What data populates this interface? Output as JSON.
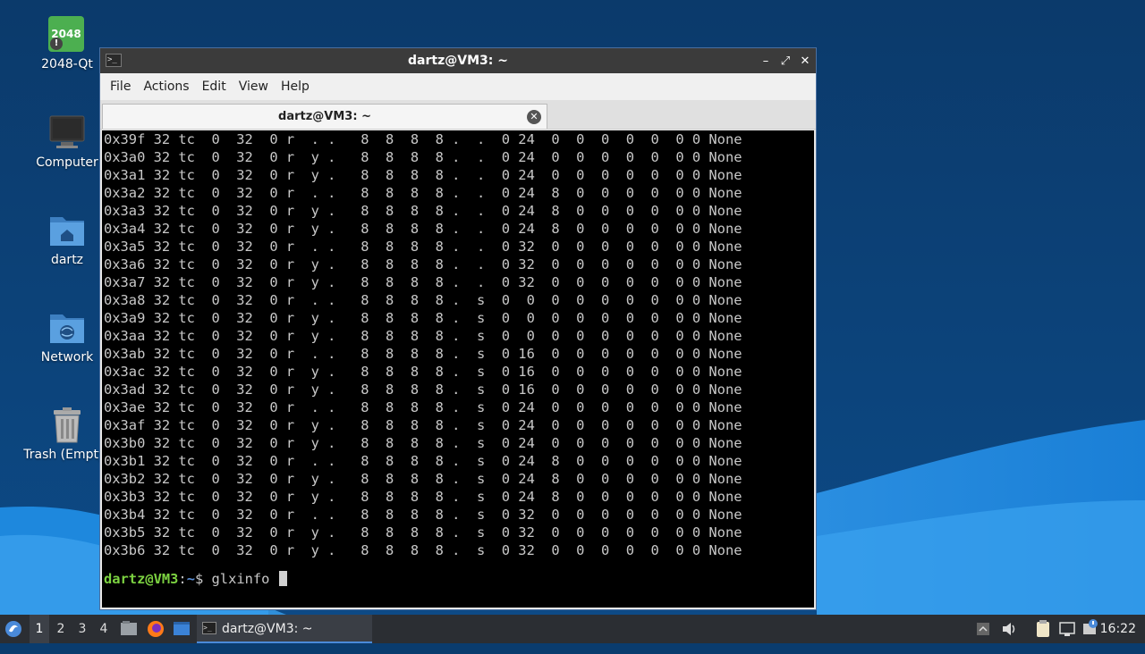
{
  "desktop": {
    "icons": [
      {
        "label": "2048-Qt",
        "icon": "2048-app-icon",
        "badge": "2048"
      },
      {
        "label": "Computer",
        "icon": "computer-icon"
      },
      {
        "label": "dartz",
        "icon": "home-folder-icon"
      },
      {
        "label": "Network",
        "icon": "network-folder-icon"
      },
      {
        "label": "Trash (Empty)",
        "icon": "trash-icon"
      }
    ]
  },
  "window": {
    "title": "dartz@VM3: ~",
    "controls": {
      "minimize": "–",
      "maximize": "⤢",
      "close": "✕"
    },
    "menu": [
      "File",
      "Actions",
      "Edit",
      "View",
      "Help"
    ],
    "tab": {
      "label": "dartz@VM3: ~",
      "close": "✕"
    }
  },
  "terminal": {
    "lines": [
      "0x39f 32 tc  0  32  0 r  . .   8  8  8  8 .  .  0 24  0  0  0  0  0  0 0 None",
      "0x3a0 32 tc  0  32  0 r  y .   8  8  8  8 .  .  0 24  0  0  0  0  0  0 0 None",
      "0x3a1 32 tc  0  32  0 r  y .   8  8  8  8 .  .  0 24  0  0  0  0  0  0 0 None",
      "0x3a2 32 tc  0  32  0 r  . .   8  8  8  8 .  .  0 24  8  0  0  0  0  0 0 None",
      "0x3a3 32 tc  0  32  0 r  y .   8  8  8  8 .  .  0 24  8  0  0  0  0  0 0 None",
      "0x3a4 32 tc  0  32  0 r  y .   8  8  8  8 .  .  0 24  8  0  0  0  0  0 0 None",
      "0x3a5 32 tc  0  32  0 r  . .   8  8  8  8 .  .  0 32  0  0  0  0  0  0 0 None",
      "0x3a6 32 tc  0  32  0 r  y .   8  8  8  8 .  .  0 32  0  0  0  0  0  0 0 None",
      "0x3a7 32 tc  0  32  0 r  y .   8  8  8  8 .  .  0 32  0  0  0  0  0  0 0 None",
      "0x3a8 32 tc  0  32  0 r  . .   8  8  8  8 .  s  0  0  0  0  0  0  0  0 0 None",
      "0x3a9 32 tc  0  32  0 r  y .   8  8  8  8 .  s  0  0  0  0  0  0  0  0 0 None",
      "0x3aa 32 tc  0  32  0 r  y .   8  8  8  8 .  s  0  0  0  0  0  0  0  0 0 None",
      "0x3ab 32 tc  0  32  0 r  . .   8  8  8  8 .  s  0 16  0  0  0  0  0  0 0 None",
      "0x3ac 32 tc  0  32  0 r  y .   8  8  8  8 .  s  0 16  0  0  0  0  0  0 0 None",
      "0x3ad 32 tc  0  32  0 r  y .   8  8  8  8 .  s  0 16  0  0  0  0  0  0 0 None",
      "0x3ae 32 tc  0  32  0 r  . .   8  8  8  8 .  s  0 24  0  0  0  0  0  0 0 None",
      "0x3af 32 tc  0  32  0 r  y .   8  8  8  8 .  s  0 24  0  0  0  0  0  0 0 None",
      "0x3b0 32 tc  0  32  0 r  y .   8  8  8  8 .  s  0 24  0  0  0  0  0  0 0 None",
      "0x3b1 32 tc  0  32  0 r  . .   8  8  8  8 .  s  0 24  8  0  0  0  0  0 0 None",
      "0x3b2 32 tc  0  32  0 r  y .   8  8  8  8 .  s  0 24  8  0  0  0  0  0 0 None",
      "0x3b3 32 tc  0  32  0 r  y .   8  8  8  8 .  s  0 24  8  0  0  0  0  0 0 None",
      "0x3b4 32 tc  0  32  0 r  . .   8  8  8  8 .  s  0 32  0  0  0  0  0  0 0 None",
      "0x3b5 32 tc  0  32  0 r  y .   8  8  8  8 .  s  0 32  0  0  0  0  0  0 0 None",
      "0x3b6 32 tc  0  32  0 r  y .   8  8  8  8 .  s  0 32  0  0  0  0  0  0 0 None"
    ],
    "prompt": {
      "user_host": "dartz@VM3",
      "sep": ":",
      "path": "~",
      "symbol": "$",
      "command": "glxinfo"
    }
  },
  "taskbar": {
    "workspaces": [
      "1",
      "2",
      "3",
      "4"
    ],
    "active_workspace": "1",
    "task": "dartz@VM3: ~",
    "clock": "16:22"
  },
  "colors": {
    "desktop": "#0a3c6e",
    "accent": "#4a8ad9",
    "prompt_user": "#7cd241",
    "prompt_path": "#5b8fd6"
  }
}
